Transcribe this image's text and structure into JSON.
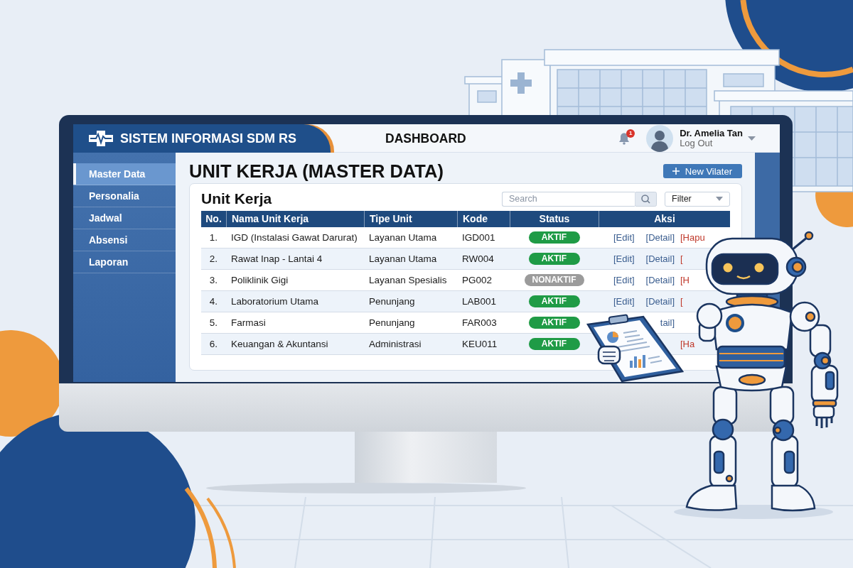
{
  "app": {
    "brand": "SISTEM INFORMASI SDM RS",
    "page_title": "DASHBOARD",
    "notification_count": "1",
    "user": {
      "name": "Dr. Amelia Tan",
      "action": "Log Out"
    }
  },
  "sidebar": {
    "items": [
      {
        "label": "Master Data",
        "selected": true
      },
      {
        "label": "Personalia",
        "selected": false
      },
      {
        "label": "Jadwal",
        "selected": false
      },
      {
        "label": "Absensi",
        "selected": false
      },
      {
        "label": "Laporan",
        "selected": false
      }
    ]
  },
  "content": {
    "title": "UNIT KERJA (MASTER DATA)",
    "new_button": "New Vilater",
    "card_title": "Unit Kerja",
    "search": {
      "placeholder": "Search"
    },
    "filter": {
      "value": "Filter"
    }
  },
  "table": {
    "columns": [
      "No.",
      "Nama Unit Kerja",
      "Tipe Unit",
      "Kode",
      "Status",
      "Aksi"
    ],
    "rows": [
      {
        "no": "1.",
        "name": "IGD (Instalasi Gawat Darurat)",
        "type": "Layanan Utama",
        "code": "IGD001",
        "status": {
          "label": "AKTIF",
          "active": true
        },
        "actions": [
          {
            "kind": "edit",
            "label": "[Edit]"
          },
          {
            "kind": "detail",
            "label": "[Detail]"
          },
          {
            "kind": "delete",
            "label": "[Hapu"
          }
        ]
      },
      {
        "no": "2.",
        "name": "Rawat Inap - Lantai 4",
        "type": "Layanan Utama",
        "code": "RW004",
        "status": {
          "label": "AKTIF",
          "active": true
        },
        "actions": [
          {
            "kind": "edit",
            "label": "[Edit]"
          },
          {
            "kind": "detail",
            "label": "[Detail]"
          },
          {
            "kind": "delete",
            "label": "["
          }
        ]
      },
      {
        "no": "3.",
        "name": "Poliklinik Gigi",
        "type": "Layanan Spesialis",
        "code": "PG002",
        "status": {
          "label": "NONAKTIF",
          "active": false
        },
        "actions": [
          {
            "kind": "edit",
            "label": "[Edit]"
          },
          {
            "kind": "detail",
            "label": "[Detail]"
          },
          {
            "kind": "delete",
            "label": "[H"
          }
        ]
      },
      {
        "no": "4.",
        "name": "Laboratorium Utama",
        "type": "Penunjang",
        "code": "LAB001",
        "status": {
          "label": "AKTIF",
          "active": true
        },
        "actions": [
          {
            "kind": "edit",
            "label": "[Edit]"
          },
          {
            "kind": "detail",
            "label": "[Detail]"
          },
          {
            "kind": "delete",
            "label": "["
          }
        ]
      },
      {
        "no": "5.",
        "name": "Farmasi",
        "type": "Penunjang",
        "code": "FAR003",
        "status": {
          "label": "AKTIF",
          "active": true
        },
        "actions": [
          {
            "kind": "detail",
            "label": "tail]"
          }
        ]
      },
      {
        "no": "6.",
        "name": "Keuangan & Akuntansi",
        "type": "Administrasi",
        "code": "KEU011",
        "status": {
          "label": "AKTIF",
          "active": true
        },
        "actions": [
          {
            "kind": "delete",
            "label": "[Ha"
          }
        ]
      }
    ]
  }
}
